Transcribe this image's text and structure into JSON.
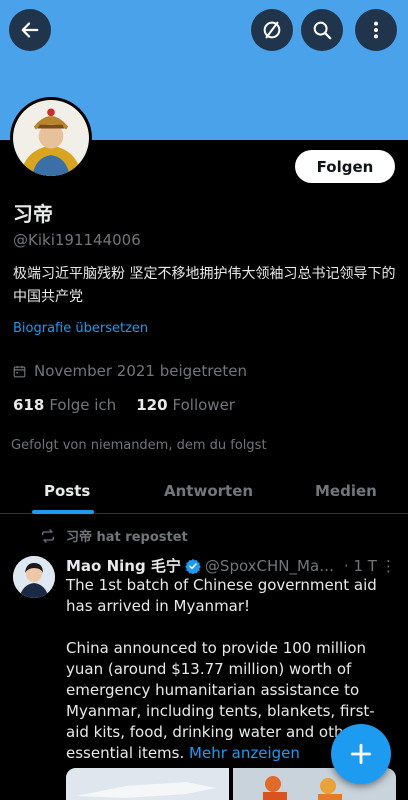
{
  "header": {
    "back_icon": "arrow-left-icon",
    "grok_icon": "slash-circle-icon",
    "search_icon": "search-icon",
    "more_icon": "more-vertical-icon",
    "banner_color": "#4aa3ea"
  },
  "profile": {
    "follow_label": "Folgen",
    "name": "习帝",
    "handle": "@Kiki191144006",
    "bio": "极端习近平脑残粉 坚定不移地拥护伟大领袖习总书记领导下的中国共产党",
    "translate_label": "Biografie übersetzen",
    "joined": "November 2021 beigetreten",
    "following_count": "618",
    "following_label": "Folge ich",
    "followers_count": "120",
    "followers_label": "Follower",
    "followed_by": "Gefolgt von niemandem, dem du folgst"
  },
  "tabs": [
    {
      "label": "Posts",
      "active": true
    },
    {
      "label": "Antworten",
      "active": false
    },
    {
      "label": "Medien",
      "active": false
    }
  ],
  "feed": {
    "repost_text": "习帝 hat repostet",
    "tweet": {
      "author_name": "Mao Ning 毛宁",
      "author_handle": "@SpoxCHN_Mao...",
      "time": "· 1 T",
      "paragraph1": "The 1st batch of Chinese government aid has arrived in Myanmar!",
      "paragraph2": "China announced to provide 100 million yuan (around $13.77 million) worth of emergency humanitarian assistance to Myanmar, including tents, blankets, first-aid kits, food, drinking water and other essential items.",
      "more_label": "Mehr anzeigen"
    }
  },
  "fab": {
    "icon": "plus-icon"
  }
}
